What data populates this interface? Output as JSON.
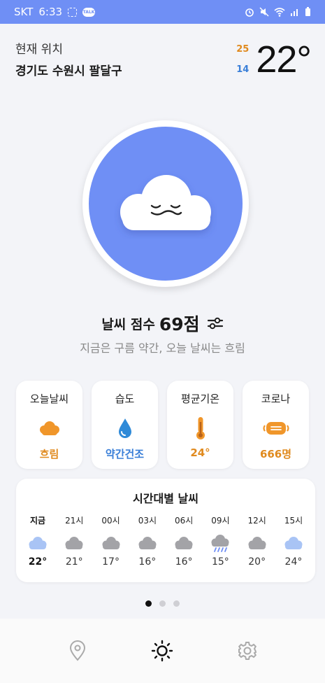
{
  "status_bar": {
    "carrier": "SKT",
    "time": "6:33"
  },
  "location": {
    "label": "현재 위치",
    "name": "경기도 수원시 팔달구"
  },
  "temperature": {
    "high": "25",
    "low": "14",
    "current": "22°"
  },
  "score": {
    "label": "날씨 점수",
    "value": "69점"
  },
  "summary": "지금은 구름 약간, 오늘 날씨는 흐림",
  "cards": [
    {
      "title": "오늘날씨",
      "value": "흐림",
      "color": "#e08a1e",
      "icon": "cloud-icon"
    },
    {
      "title": "습도",
      "value": "약간건조",
      "color": "#3a7fd8",
      "icon": "water-drop-icon"
    },
    {
      "title": "평균기온",
      "value": "24°",
      "color": "#e08a1e",
      "icon": "thermometer-icon"
    },
    {
      "title": "코로나",
      "value": "666명",
      "color": "#e08a1e",
      "icon": "face-mask-icon"
    }
  ],
  "hourly": {
    "title": "시간대별 날씨",
    "hours": [
      {
        "label": "지금",
        "temp": "22°",
        "icon": "cloud-light-blue-icon"
      },
      {
        "label": "21시",
        "temp": "21°",
        "icon": "cloud-gray-icon"
      },
      {
        "label": "00시",
        "temp": "17°",
        "icon": "cloud-gray-icon"
      },
      {
        "label": "03시",
        "temp": "16°",
        "icon": "cloud-gray-icon"
      },
      {
        "label": "06시",
        "temp": "16°",
        "icon": "cloud-gray-icon"
      },
      {
        "label": "09시",
        "temp": "15°",
        "icon": "rain-cloud-icon"
      },
      {
        "label": "12시",
        "temp": "20°",
        "icon": "cloud-gray-icon"
      },
      {
        "label": "15시",
        "temp": "24°",
        "icon": "cloud-light-blue-icon"
      }
    ]
  },
  "pager": {
    "count": 3,
    "active": 0
  },
  "colors": {
    "accent": "#6f8ff5",
    "orange": "#e08a1e",
    "blue": "#3a7fd8"
  },
  "nav": [
    "location-pin-icon",
    "sun-icon",
    "gear-icon"
  ]
}
